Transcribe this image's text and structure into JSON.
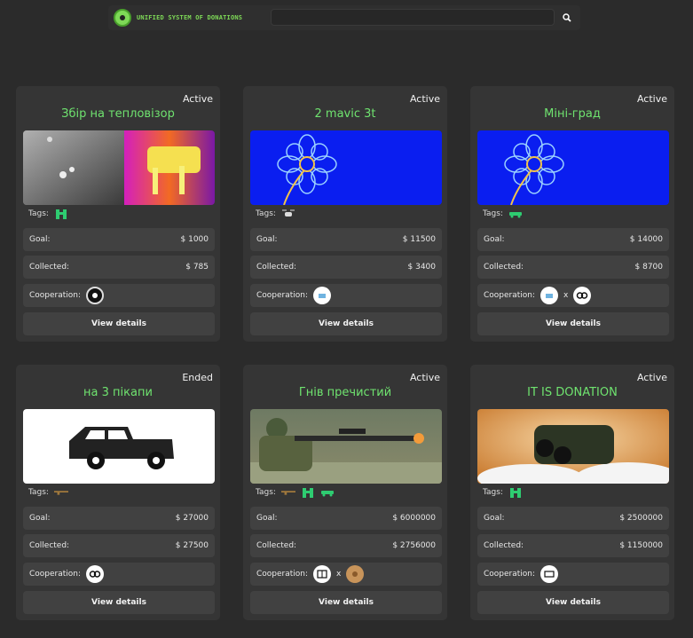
{
  "header": {
    "brand": "UNIFIED SYSTEM OF DONATIONS",
    "search_placeholder": "",
    "accent": "#7ed957"
  },
  "labels": {
    "tags": "Tags:",
    "goal": "Goal:",
    "collected": "Collected:",
    "cooperation": "Cooperation:",
    "view": "View details",
    "x": "x"
  },
  "cards": [
    {
      "status": "Active",
      "title": "Збір на тепловізор",
      "goal": "$ 1000",
      "collected": "$ 785",
      "image": "thermal-photo",
      "tags": [
        "binoculars-icon"
      ],
      "coop": [
        "partner-logo-dark"
      ]
    },
    {
      "status": "Active",
      "title": "2 mavic 3t",
      "goal": "$ 11500",
      "collected": "$ 3400",
      "image": "flower-placeholder",
      "tags": [
        "drone-icon"
      ],
      "coop": [
        "partner-logo-light"
      ]
    },
    {
      "status": "Active",
      "title": "Міні-град",
      "goal": "$ 14000",
      "collected": "$ 8700",
      "image": "flower-placeholder",
      "tags": [
        "vehicle-icon"
      ],
      "coop": [
        "partner-logo-light",
        "partner-logo-rings"
      ]
    },
    {
      "status": "Ended",
      "title": "на 3 пікапи",
      "goal": "$ 27000",
      "collected": "$ 27500",
      "image": "pickup-truck",
      "tags": [
        "rifle-icon"
      ],
      "coop": [
        "partner-logo-rings"
      ]
    },
    {
      "status": "Active",
      "title": "Гнів пречистий",
      "goal": "$ 6000000",
      "collected": "$ 2756000",
      "image": "sniper-photo",
      "tags": [
        "rifle-icon",
        "binoculars-icon",
        "vehicle-icon"
      ],
      "coop": [
        "partner-logo-grid",
        "partner-logo-emblem"
      ]
    },
    {
      "status": "Active",
      "title": "IT IS DONATION",
      "goal": "$ 2500000",
      "collected": "$ 1150000",
      "image": "binoculars-photo",
      "tags": [
        "binoculars-icon"
      ],
      "coop": [
        "partner-logo-card"
      ]
    }
  ]
}
